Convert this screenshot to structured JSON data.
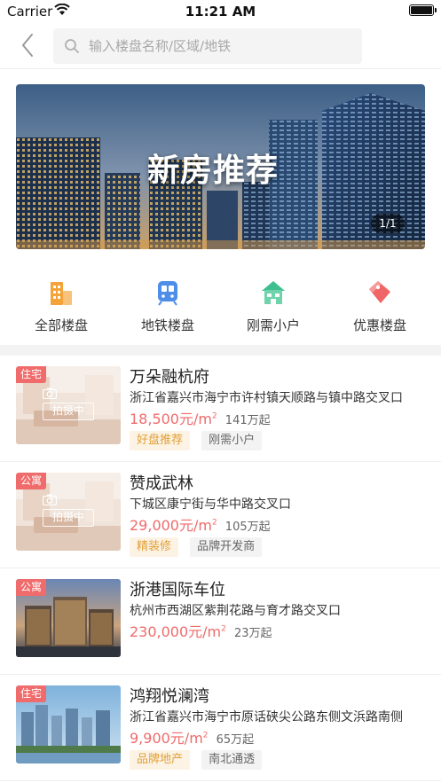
{
  "status_bar": {
    "carrier": "Carrier",
    "time": "11:21 AM"
  },
  "search": {
    "placeholder": "输入楼盘名称/区域/地铁",
    "value": ""
  },
  "banner": {
    "title": "新房推荐",
    "indicator": "1/1"
  },
  "categories": [
    {
      "label": "全部楼盘",
      "icon": "building-icon",
      "color": "#f4a23a"
    },
    {
      "label": "地铁楼盘",
      "icon": "metro-icon",
      "color": "#4e8ee8"
    },
    {
      "label": "刚需小户",
      "icon": "house-icon",
      "color": "#3fbf8f"
    },
    {
      "label": "优惠楼盘",
      "icon": "price-tag-icon",
      "color": "#f06565"
    }
  ],
  "listings": [
    {
      "badge": "住宅",
      "photo_label": "拍摄中",
      "name": "万朵融杭府",
      "address": "浙江省嘉兴市海宁市许村镇天顺路与镇中路交叉口",
      "price": "18,500元/m",
      "price_sup": "2",
      "total": "141万起",
      "tags": [
        "好盘推荐",
        "刚需小户"
      ]
    },
    {
      "badge": "公寓",
      "photo_label": "拍摄中",
      "name": "赞成武林",
      "address": "下城区康宁街与华中路交叉口",
      "price": "29,000元/m",
      "price_sup": "2",
      "total": "105万起",
      "tags": [
        "精装修",
        "品牌开发商"
      ]
    },
    {
      "badge": "公寓",
      "name": "浙港国际车位",
      "address": "杭州市西湖区紫荆花路与育才路交叉口",
      "price": "230,000元/m",
      "price_sup": "2",
      "total": "23万起",
      "tags": []
    },
    {
      "badge": "住宅",
      "name": "鸿翔悦澜湾",
      "address": "浙江省嘉兴市海宁市原话硖尖公路东侧文浜路南侧",
      "price": "9,900元/m",
      "price_sup": "2",
      "total": "65万起",
      "tags": [
        "品牌地产",
        "南北通透"
      ]
    }
  ],
  "colors": {
    "accent": "#ef6b6b",
    "highlight_tag": "#e0a037"
  }
}
